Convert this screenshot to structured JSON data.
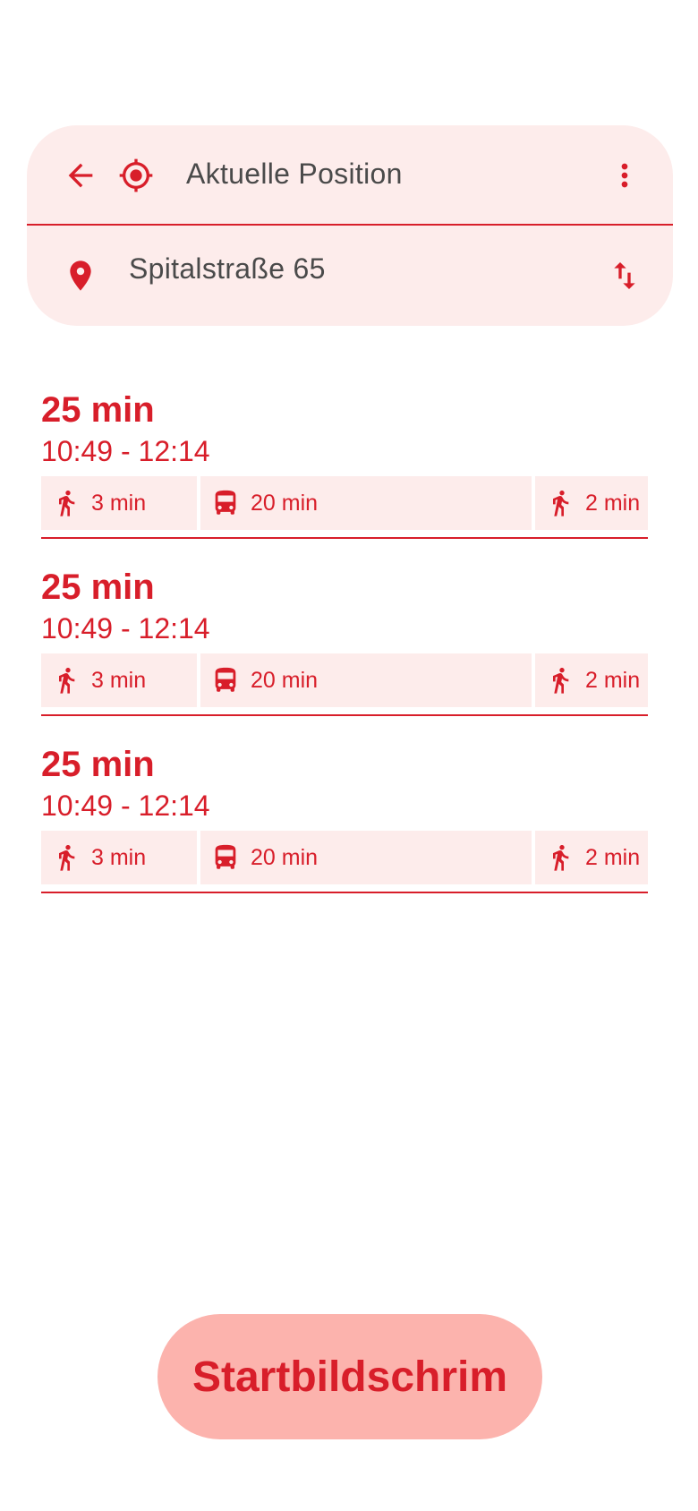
{
  "search": {
    "origin_text": "Aktuelle Position",
    "destination_text": "Spitalstraße 65"
  },
  "routes": [
    {
      "duration": "25 min",
      "times": "10:49 - 12:14",
      "legs": [
        {
          "mode": "walk-icon",
          "label": "3 min"
        },
        {
          "mode": "bus-icon",
          "label": "20 min"
        },
        {
          "mode": "walk-icon",
          "label": "2 min"
        }
      ]
    },
    {
      "duration": "25 min",
      "times": "10:49 - 12:14",
      "legs": [
        {
          "mode": "walk-icon",
          "label": "3 min"
        },
        {
          "mode": "bus-icon",
          "label": "20 min"
        },
        {
          "mode": "walk-icon",
          "label": "2 min"
        }
      ]
    },
    {
      "duration": "25 min",
      "times": "10:49 - 12:14",
      "legs": [
        {
          "mode": "walk-icon",
          "label": "3 min"
        },
        {
          "mode": "bus-icon",
          "label": "20 min"
        },
        {
          "mode": "walk-icon",
          "label": "2 min"
        }
      ]
    }
  ],
  "home_button": {
    "label": "Startbildschrim"
  },
  "colors": {
    "accent": "#d81e2a",
    "surface": "#fdeceb",
    "button": "#fcb3ad",
    "field_text": "#4a4a4a"
  }
}
